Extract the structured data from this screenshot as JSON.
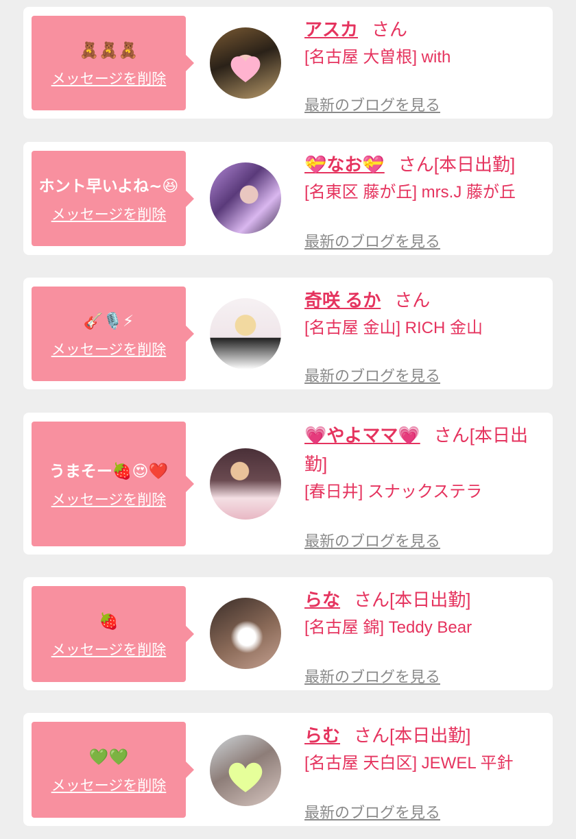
{
  "delete_label": "メッセージを削除",
  "blog_label": "最新のブログを見る",
  "cards": [
    {
      "message": "🧸🧸🧸",
      "name": "アスカ",
      "honorific": "さん",
      "shop": "[名古屋 大曽根] with",
      "avatar_overlay": "pink-heart"
    },
    {
      "message": "ホント早いよね~😆",
      "name": "💝なお💝",
      "honorific": "さん[本日出勤]",
      "shop": "[名東区 藤が丘] mrs.J 藤が丘"
    },
    {
      "message": "🎸🎙️⚡",
      "name": "奇咲 るか",
      "honorific": "さん",
      "shop": "[名古屋 金山] RICH 金山"
    },
    {
      "message": "うまそー🍓😍❤️",
      "name": "💗やよママ💗",
      "honorific": "さん[本日出勤]",
      "shop": "[春日井] スナックステラ"
    },
    {
      "message": "🍓",
      "name": "らな",
      "honorific": "さん[本日出勤]",
      "shop": "[名古屋 錦] Teddy Bear"
    },
    {
      "message": "💚💚",
      "name": "らむ",
      "honorific": "さん[本日出勤]",
      "shop": "[名古屋 天白区] JEWEL 平針",
      "avatar_overlay": "green-heart"
    }
  ],
  "colors": {
    "bubble": "#f8909f",
    "name": "#e5335e",
    "blog": "#8a8a8a",
    "background": "#eeeeee"
  }
}
